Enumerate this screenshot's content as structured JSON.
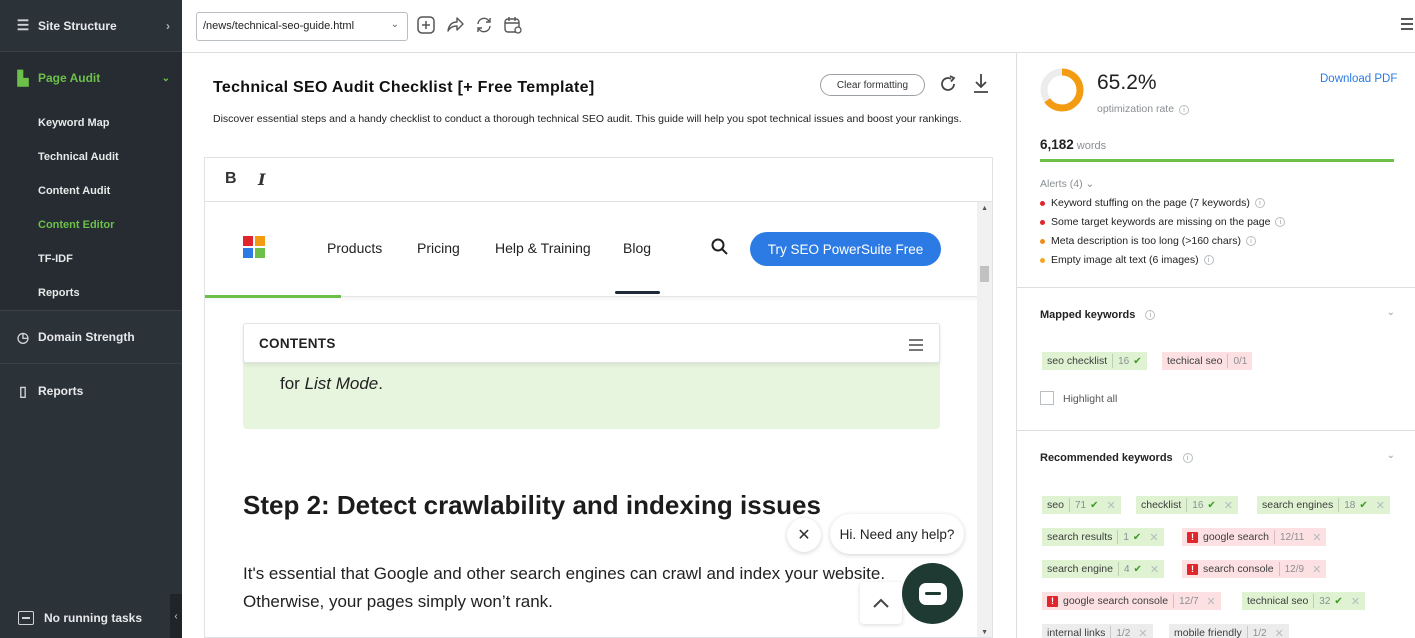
{
  "sidebar": {
    "site_structure": "Site Structure",
    "page_audit": "Page Audit",
    "sub_items": [
      "Keyword Map",
      "Technical Audit",
      "Content Audit",
      "Content Editor",
      "TF-IDF",
      "Reports"
    ],
    "active_sub": "Content Editor",
    "domain_strength": "Domain Strength",
    "reports": "Reports",
    "tasks": "No running tasks",
    "accent": "#6cc04a"
  },
  "toolbar": {
    "url": "/news/technical-seo-guide.html",
    "icons": [
      "add-icon",
      "share-icon",
      "sync-icon",
      "calendar-icon",
      "hamburger-icon"
    ]
  },
  "editor": {
    "title": "Technical SEO Audit Checklist [+ Free Template]",
    "description": "Discover essential steps and a handy checklist to conduct a thorough technical SEO audit. This guide will help you spot technical issues and boost your rankings.",
    "clear_formatting": "Clear formatting",
    "bold": "B",
    "italic": "I"
  },
  "preview": {
    "nav": [
      "Products",
      "Pricing",
      "Help & Training",
      "Blog"
    ],
    "cta": "Try SEO PowerSuite Free",
    "contents": "CONTENTS",
    "green_text_prefix": "for ",
    "green_text_em": "List Mode",
    "green_text_suffix": ".",
    "heading": "Step 2: Detect crawlability and indexing issues",
    "paragraph": "It's essential that Google and other search engines can crawl and index your website. Otherwise, your pages simply won’t rank.",
    "chat_prompt": "Hi. Need any help?"
  },
  "panel": {
    "rate": "65.2%",
    "rate_value": 0.652,
    "rate_label": "optimization rate",
    "download_pdf": "Download PDF",
    "words": "6,182",
    "words_unit": "words",
    "alerts_header": "Alerts (4)",
    "alerts": [
      {
        "text": "Keyword stuffing on the page (7 keywords)",
        "color": "#e0252c"
      },
      {
        "text": "Some target keywords are missing on the page",
        "color": "#e0252c"
      },
      {
        "text": "Meta description is too long (>160 chars)",
        "color": "#f08c1e"
      },
      {
        "text": "Empty image alt text (6 images)",
        "color": "#f5a623"
      }
    ],
    "mapped_header": "Mapped keywords",
    "mapped": [
      {
        "kw": "seo checklist",
        "count": "16",
        "state": "ok"
      },
      {
        "kw": "techical seo",
        "count": "0/1",
        "state": "missing"
      }
    ],
    "highlight_all": "Highlight all",
    "recommended_header": "Recommended keywords",
    "recommended": [
      {
        "kw": "seo",
        "count": "71",
        "state": "ok"
      },
      {
        "kw": "checklist",
        "count": "16",
        "state": "ok"
      },
      {
        "kw": "search engines",
        "count": "18",
        "state": "ok"
      },
      {
        "kw": "search results",
        "count": "1",
        "state": "ok"
      },
      {
        "kw": "google search",
        "count": "12/11",
        "state": "over"
      },
      {
        "kw": "search engine",
        "count": "4",
        "state": "ok"
      },
      {
        "kw": "search console",
        "count": "12/9",
        "state": "over"
      },
      {
        "kw": "google search console",
        "count": "12/7",
        "state": "over"
      },
      {
        "kw": "technical seo",
        "count": "32",
        "state": "ok"
      },
      {
        "kw": "internal links",
        "count": "1/2",
        "state": "neutral"
      },
      {
        "kw": "mobile friendly",
        "count": "1/2",
        "state": "neutral"
      }
    ],
    "donut_color": "#f39c12"
  }
}
